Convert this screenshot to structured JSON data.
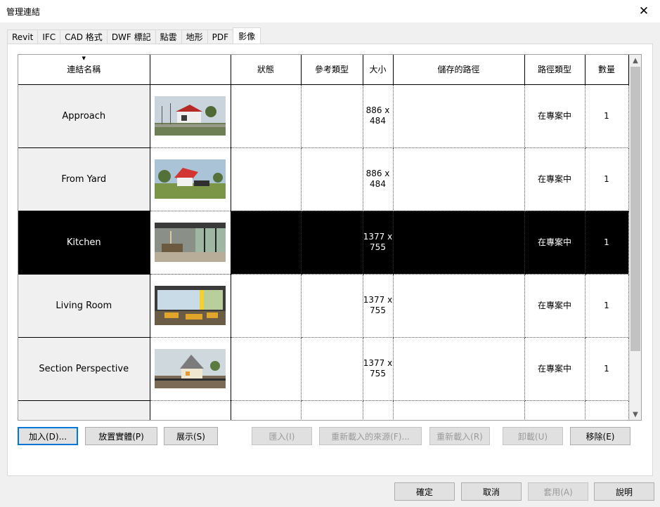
{
  "window": {
    "title": "管理連結",
    "close_icon": "close-icon"
  },
  "tabs": [
    {
      "label": "Revit",
      "active": false
    },
    {
      "label": "IFC",
      "active": false
    },
    {
      "label": "CAD 格式",
      "active": false
    },
    {
      "label": "DWF 標記",
      "active": false
    },
    {
      "label": "點雲",
      "active": false
    },
    {
      "label": "地形",
      "active": false
    },
    {
      "label": "PDF",
      "active": false
    },
    {
      "label": "影像",
      "active": true
    }
  ],
  "table": {
    "columns": [
      "連結名稱",
      "",
      "狀態",
      "參考類型",
      "大小",
      "儲存的路徑",
      "路徑類型",
      "數量"
    ],
    "sort_icon": "sort-descending-icon",
    "rows": [
      {
        "name": "Approach",
        "status": "",
        "ref_type": "",
        "size": "886 x 484",
        "saved_path": "",
        "path_type": "在專案中",
        "count": "1",
        "selected": false,
        "thumb": "approach"
      },
      {
        "name": "From Yard",
        "status": "",
        "ref_type": "",
        "size": "886 x 484",
        "saved_path": "",
        "path_type": "在專案中",
        "count": "1",
        "selected": false,
        "thumb": "yard"
      },
      {
        "name": "Kitchen",
        "status": "",
        "ref_type": "",
        "size": "1377 x 755",
        "saved_path": "",
        "path_type": "在專案中",
        "count": "1",
        "selected": true,
        "thumb": "kitchen"
      },
      {
        "name": "Living Room",
        "status": "",
        "ref_type": "",
        "size": "1377 x 755",
        "saved_path": "",
        "path_type": "在專案中",
        "count": "1",
        "selected": false,
        "thumb": "living"
      },
      {
        "name": "Section Perspective",
        "status": "",
        "ref_type": "",
        "size": "1377 x 755",
        "saved_path": "",
        "path_type": "在專案中",
        "count": "1",
        "selected": false,
        "thumb": "section"
      },
      {
        "name": "",
        "status": "",
        "ref_type": "",
        "size": "",
        "saved_path": "",
        "path_type": "",
        "count": "",
        "selected": false,
        "thumb": ""
      }
    ]
  },
  "scrollbar": {
    "up_icon": "scroll-up-icon",
    "down_icon": "scroll-down-icon"
  },
  "actions": {
    "add": "加入(D)...",
    "place_instance": "放置實體(P)",
    "show": "展示(S)",
    "import": "匯入(I)",
    "reload_from": "重新載入的來源(F)...",
    "reload": "重新載入(R)",
    "unload": "卸載(U)",
    "remove": "移除(E)"
  },
  "footer": {
    "ok": "確定",
    "cancel": "取消",
    "apply": "套用(A)",
    "help": "說明"
  }
}
